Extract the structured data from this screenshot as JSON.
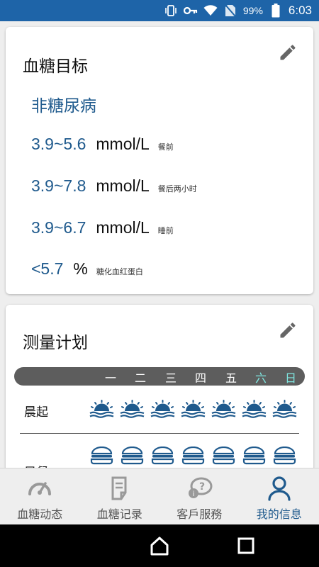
{
  "status_bar": {
    "battery_pct": "99%",
    "time": "6:03",
    "icons": [
      "vibrate-icon",
      "key-icon",
      "wifi-icon",
      "no-sim-icon",
      "battery-icon"
    ]
  },
  "goal_card": {
    "title": "血糖目标",
    "type": "非糖尿病",
    "rows": [
      {
        "range": "3.9~5.6",
        "unit": "mmol/L",
        "note": "餐前"
      },
      {
        "range": "3.9~7.8",
        "unit": "mmol/L",
        "note": "餐后两小时"
      },
      {
        "range": "3.9~6.7",
        "unit": "mmol/L",
        "note": "睡前"
      },
      {
        "range": "<5.7",
        "unit": "%",
        "note": "糖化血红蛋白"
      }
    ],
    "edit_icon": "pencil-icon"
  },
  "plan_card": {
    "title": "测量计划",
    "days": [
      "一",
      "二",
      "三",
      "四",
      "五",
      "六",
      "日"
    ],
    "rows": [
      {
        "label": "晨起",
        "icon": "sunrise-icon"
      },
      {
        "label": "早餐",
        "icon": "burger-icon"
      }
    ],
    "edit_icon": "pencil-icon"
  },
  "bottom_nav": [
    {
      "label": "血糖动态",
      "icon": "gauge-icon",
      "active": false
    },
    {
      "label": "血糖记录",
      "icon": "document-icon",
      "active": false
    },
    {
      "label": "客戶服務",
      "icon": "chat-question-icon",
      "active": false
    },
    {
      "label": "我的信息",
      "icon": "user-icon",
      "active": true
    }
  ],
  "colors": {
    "status_bar": "#1e64a8",
    "accent": "#1f5a8d",
    "weekend": "#7fe6e0",
    "week_bar": "#5d5d5d"
  }
}
